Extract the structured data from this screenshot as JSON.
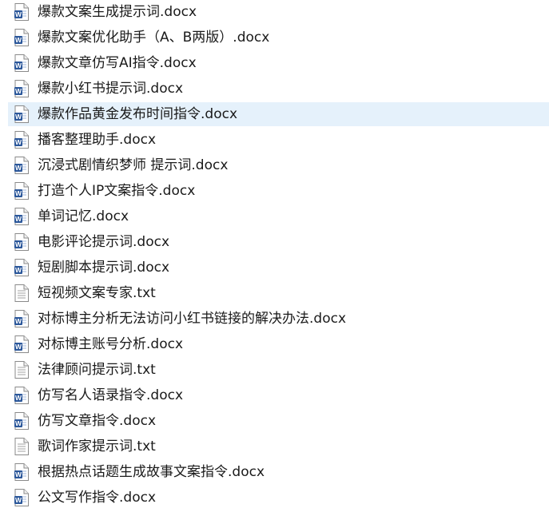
{
  "files": [
    {
      "name": "爆款文案生成提示词.docx",
      "icon": "word-document-icon",
      "selected": false
    },
    {
      "name": "爆款文案优化助手（A、B两版）.docx",
      "icon": "word-document-icon",
      "selected": false
    },
    {
      "name": "爆款文章仿写AI指令.docx",
      "icon": "word-document-icon",
      "selected": false
    },
    {
      "name": "爆款小红书提示词.docx",
      "icon": "word-document-icon",
      "selected": false
    },
    {
      "name": "爆款作品黄金发布时间指令.docx",
      "icon": "word-document-icon",
      "selected": true
    },
    {
      "name": "播客整理助手.docx",
      "icon": "word-document-icon",
      "selected": false
    },
    {
      "name": "沉浸式剧情织梦师 提示词.docx",
      "icon": "word-document-icon",
      "selected": false
    },
    {
      "name": "打造个人IP文案指令.docx",
      "icon": "word-document-icon",
      "selected": false
    },
    {
      "name": "单词记忆.docx",
      "icon": "word-document-icon",
      "selected": false
    },
    {
      "name": "电影评论提示词.docx",
      "icon": "word-document-icon",
      "selected": false
    },
    {
      "name": "短剧脚本提示词.docx",
      "icon": "word-document-icon",
      "selected": false
    },
    {
      "name": "短视频文案专家.txt",
      "icon": "text-file-icon",
      "selected": false
    },
    {
      "name": "对标博主分析无法访问小红书链接的解决办法.docx",
      "icon": "word-document-icon",
      "selected": false
    },
    {
      "name": "对标博主账号分析.docx",
      "icon": "word-document-icon",
      "selected": false
    },
    {
      "name": "法律顾问提示词.txt",
      "icon": "text-file-icon",
      "selected": false
    },
    {
      "name": "仿写名人语录指令.docx",
      "icon": "word-document-icon",
      "selected": false
    },
    {
      "name": "仿写文章指令.docx",
      "icon": "word-document-icon",
      "selected": false
    },
    {
      "name": "歌词作家提示词.txt",
      "icon": "text-file-icon",
      "selected": false
    },
    {
      "name": "根据热点话题生成故事文案指令.docx",
      "icon": "word-document-icon",
      "selected": false
    },
    {
      "name": "公文写作指令.docx",
      "icon": "word-document-icon",
      "selected": false
    }
  ],
  "colors": {
    "word_blue": "#2b579a",
    "selection": "#e5f1fb"
  }
}
